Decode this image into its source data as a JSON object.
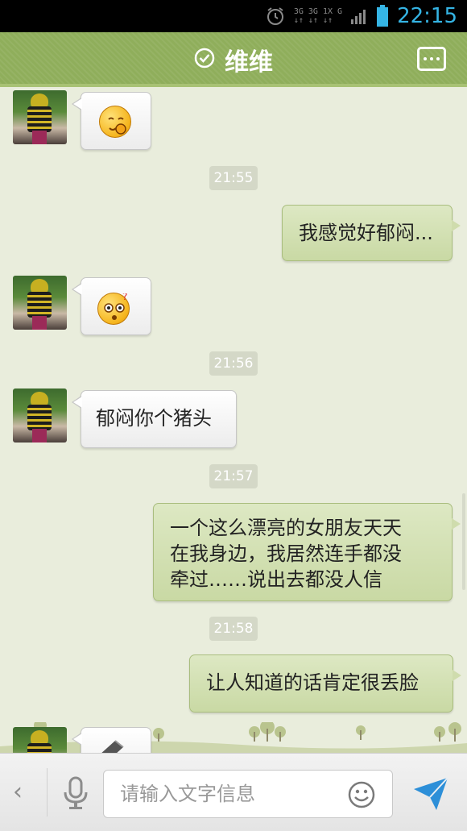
{
  "status_bar": {
    "time": "22:15",
    "net_top": "3G 3G 1X G",
    "net_bottom": "↓↑ ↓↑ ↓↑",
    "icons": [
      "alarm-icon",
      "network-icon",
      "signal-icon",
      "battery-icon"
    ]
  },
  "header": {
    "title": "维维",
    "left_icon": "check-circle-icon",
    "right_icon": "more-icon"
  },
  "messages": [
    {
      "side": "left",
      "type": "emoji",
      "emoji": "blush-emoji"
    },
    {
      "side": "time",
      "text": "21:55"
    },
    {
      "side": "right",
      "type": "text",
      "lines": [
        "我感觉好郁闷..."
      ]
    },
    {
      "side": "left",
      "type": "emoji",
      "emoji": "confused-emoji"
    },
    {
      "side": "time",
      "text": "21:56"
    },
    {
      "side": "left",
      "type": "text",
      "lines": [
        "郁闷你个猪头"
      ]
    },
    {
      "side": "time",
      "text": "21:57"
    },
    {
      "side": "right",
      "type": "text",
      "lines": [
        "一个这么漂亮的女朋友天天",
        "在我身边，我居然连手都没",
        "牵过……说出去都没人信"
      ]
    },
    {
      "side": "time",
      "text": "21:58"
    },
    {
      "side": "right",
      "type": "text",
      "lines": [
        "让人知道的话肯定很丢脸"
      ]
    },
    {
      "side": "left",
      "type": "image",
      "partial": true
    }
  ],
  "input_bar": {
    "placeholder": "请输入文字信息",
    "back_icon": "back-chevron-icon",
    "mic_icon": "microphone-icon",
    "emoji_icon": "smiley-icon",
    "send_icon": "send-icon"
  },
  "colors": {
    "header_bg": "#8fae5b",
    "chat_bg": "#e9eddc",
    "outgoing_bubble": "#cfdcad",
    "incoming_bubble": "#ffffff",
    "status_time": "#35b5e5"
  }
}
